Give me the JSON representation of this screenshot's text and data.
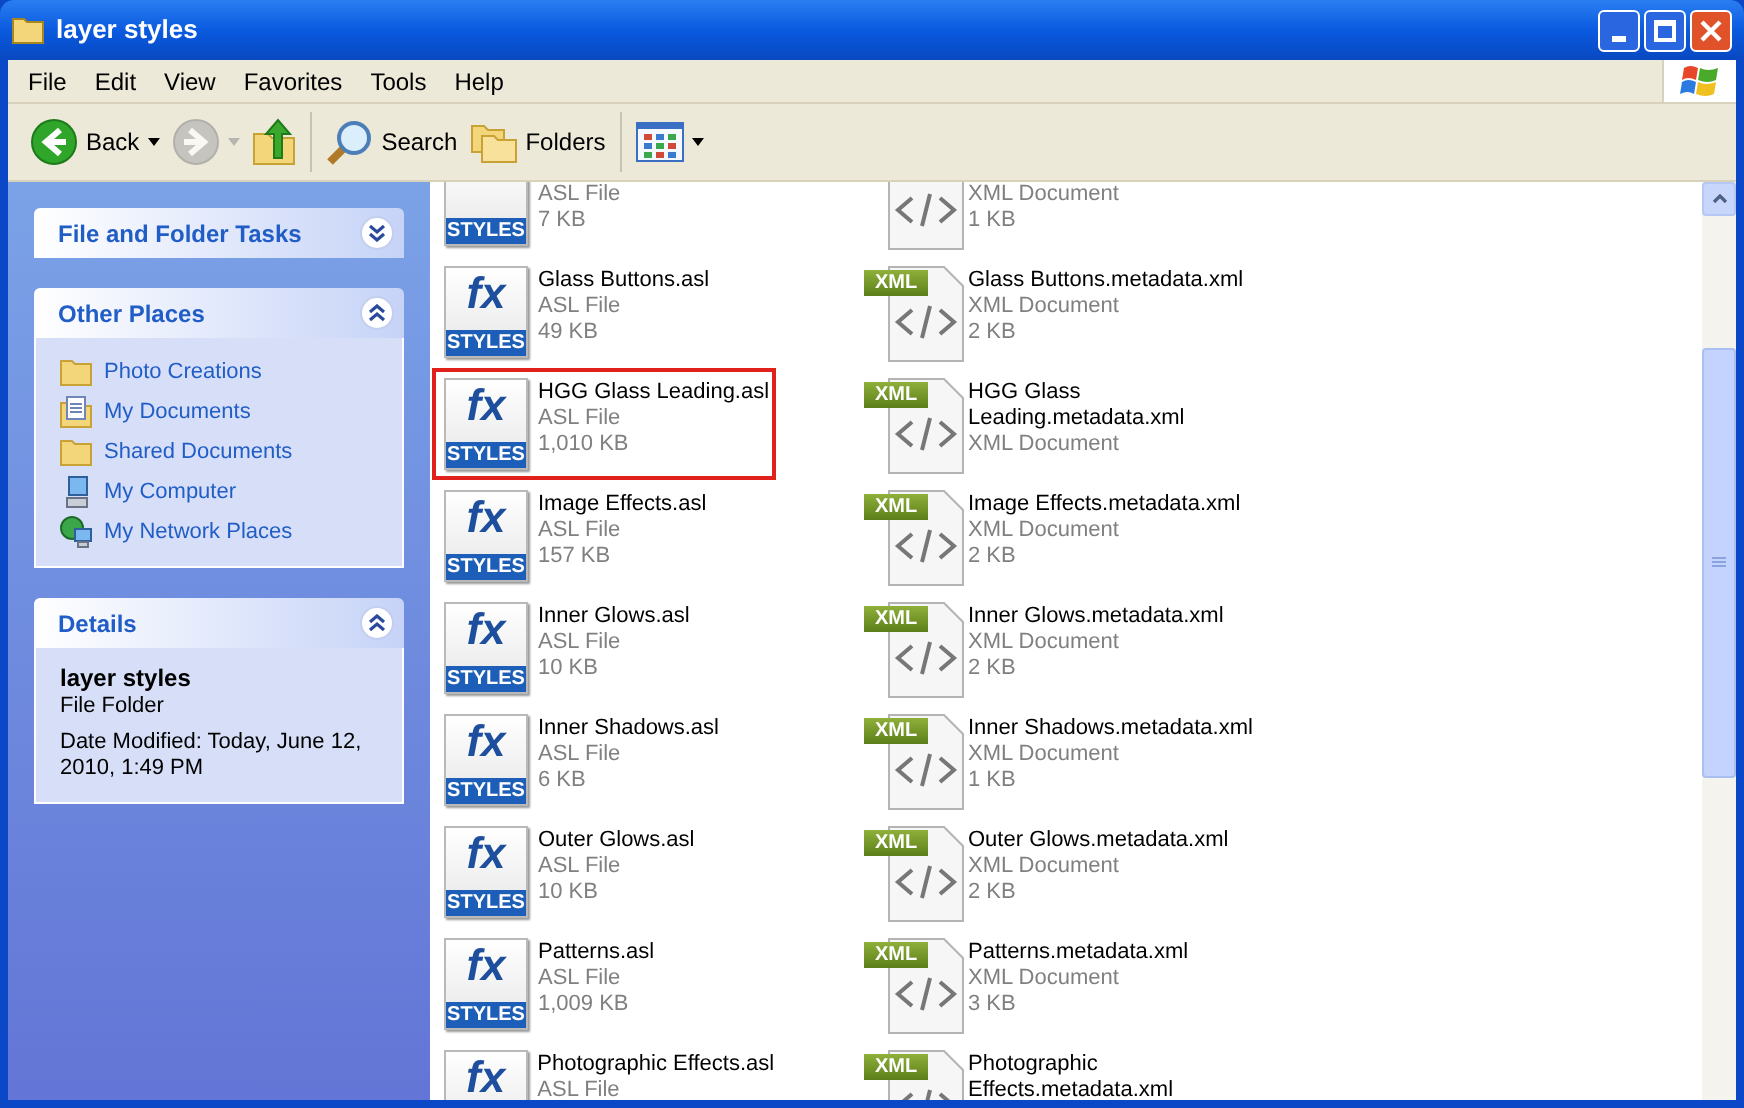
{
  "window": {
    "title": "layer styles"
  },
  "menu": [
    "File",
    "Edit",
    "View",
    "Favorites",
    "Tools",
    "Help"
  ],
  "toolbar": [
    {
      "kind": "back",
      "label": "Back",
      "disabled": false
    },
    {
      "kind": "forward",
      "disabled": true
    },
    {
      "kind": "up",
      "disabled": false
    },
    {
      "kind": "search",
      "label": "Search",
      "disabled": false
    },
    {
      "kind": "folders",
      "label": "Folders",
      "disabled": false
    },
    {
      "kind": "views",
      "disabled": false
    }
  ],
  "sidebar": [
    {
      "kind": "tasks",
      "title": "File and Folder Tasks",
      "expanded": false
    },
    {
      "kind": "places",
      "title": "Other Places",
      "expanded": true,
      "links": [
        {
          "kind": "folder",
          "label": "Photo Creations"
        },
        {
          "kind": "documents",
          "label": "My Documents"
        },
        {
          "kind": "folder",
          "label": "Shared Documents"
        },
        {
          "kind": "computer",
          "label": "My Computer"
        },
        {
          "kind": "network",
          "label": "My Network Places"
        }
      ]
    },
    {
      "kind": "details",
      "title": "Details",
      "expanded": true,
      "name": "layer styles",
      "type": "File Folder",
      "modified": "Date Modified: Today, June 12, 2010, 1:49 PM"
    }
  ],
  "files": [
    {
      "asl": {
        "badge": "STYLES",
        "type": "ASL File",
        "size": "7 KB",
        "highlighted": false
      },
      "xml": {
        "type": "XML Document",
        "size": "1 KB"
      }
    },
    {
      "asl": {
        "glyph": "fx",
        "badge": "STYLES",
        "name": "Glass Buttons.asl",
        "type": "ASL File",
        "size": "49 KB",
        "highlighted": false
      },
      "xml": {
        "badge": "XML",
        "name": "Glass Buttons.metadata.xml",
        "type": "XML Document",
        "size": "2 KB"
      }
    },
    {
      "asl": {
        "glyph": "fx",
        "badge": "STYLES",
        "name": "HGG Glass Leading.asl",
        "type": "ASL File",
        "size": "1,010 KB",
        "highlighted": true
      },
      "xml": {
        "badge": "XML",
        "name": "HGG Glass Leading.metadata.xml",
        "type": "XML Document"
      }
    },
    {
      "asl": {
        "glyph": "fx",
        "badge": "STYLES",
        "name": "Image Effects.asl",
        "type": "ASL File",
        "size": "157 KB",
        "highlighted": false
      },
      "xml": {
        "badge": "XML",
        "name": "Image Effects.metadata.xml",
        "type": "XML Document",
        "size": "2 KB"
      }
    },
    {
      "asl": {
        "glyph": "fx",
        "badge": "STYLES",
        "name": "Inner Glows.asl",
        "type": "ASL File",
        "size": "10 KB",
        "highlighted": false
      },
      "xml": {
        "badge": "XML",
        "name": "Inner Glows.metadata.xml",
        "type": "XML Document",
        "size": "2 KB"
      }
    },
    {
      "asl": {
        "glyph": "fx",
        "badge": "STYLES",
        "name": "Inner Shadows.asl",
        "type": "ASL File",
        "size": "6 KB",
        "highlighted": false
      },
      "xml": {
        "badge": "XML",
        "name": "Inner Shadows.metadata.xml",
        "type": "XML Document",
        "size": "1 KB"
      }
    },
    {
      "asl": {
        "glyph": "fx",
        "badge": "STYLES",
        "name": "Outer Glows.asl",
        "type": "ASL File",
        "size": "10 KB",
        "highlighted": false
      },
      "xml": {
        "badge": "XML",
        "name": "Outer Glows.metadata.xml",
        "type": "XML Document",
        "size": "2 KB"
      }
    },
    {
      "asl": {
        "glyph": "fx",
        "badge": "STYLES",
        "name": "Patterns.asl",
        "type": "ASL File",
        "size": "1,009 KB",
        "highlighted": false
      },
      "xml": {
        "badge": "XML",
        "name": "Patterns.metadata.xml",
        "type": "XML Document",
        "size": "3 KB"
      }
    },
    {
      "asl": {
        "glyph": "fx",
        "name": "Photographic Effects.asl",
        "type": "ASL File",
        "highlighted": false
      },
      "xml": {
        "badge": "XML",
        "name": "Photographic Effects.metadata.xml"
      }
    }
  ]
}
